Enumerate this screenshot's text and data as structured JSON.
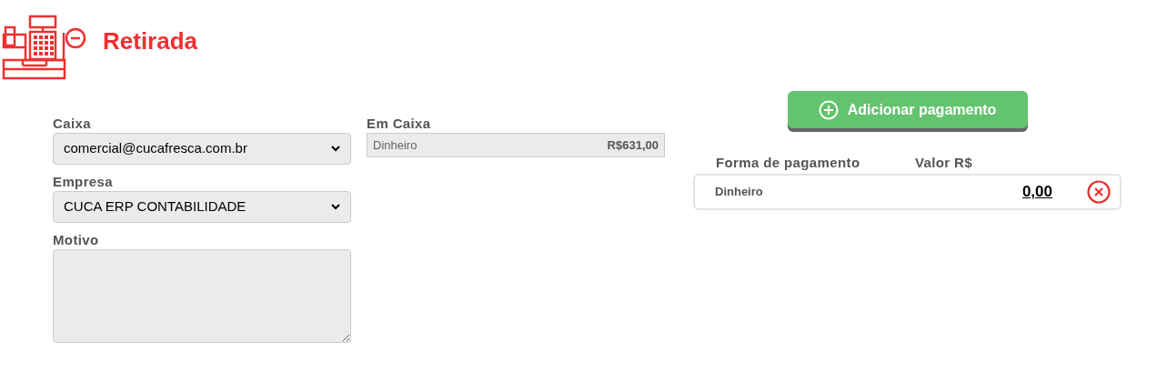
{
  "page": {
    "title": "Retirada"
  },
  "form": {
    "caixa": {
      "label": "Caixa",
      "value": "comercial@cucafresca.com.br"
    },
    "empresa": {
      "label": "Empresa",
      "value": "CUCA ERP CONTABILIDADE"
    },
    "motivo": {
      "label": "Motivo"
    }
  },
  "em_caixa": {
    "label": "Em Caixa",
    "rows": [
      {
        "name": "Dinheiro",
        "value": "R$631,00"
      }
    ]
  },
  "payments": {
    "add_button": "Adicionar pagamento",
    "columns": [
      "Forma de pagamento",
      "Valor R$"
    ],
    "rows": [
      {
        "name": "Dinheiro",
        "value": "0,00"
      }
    ]
  }
}
